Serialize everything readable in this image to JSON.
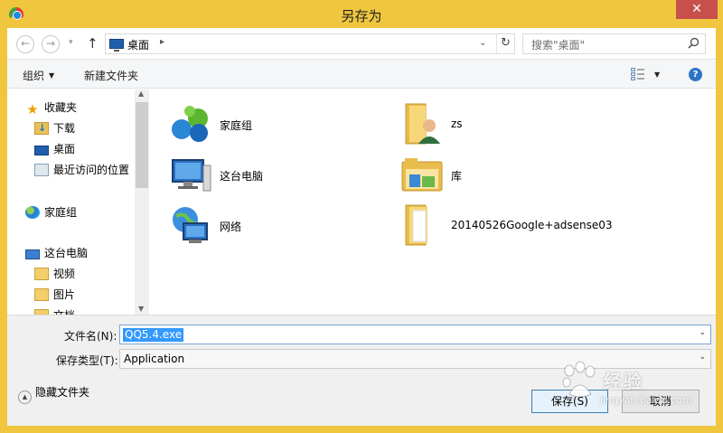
{
  "window": {
    "title": "另存为",
    "close_label": "✕"
  },
  "nav": {
    "back_label": "←",
    "forward_label": "→",
    "recent_label": "▾",
    "up_label": "↑",
    "address": {
      "location": "桌面",
      "separator": "▸",
      "dropdown": "⌄",
      "refresh": "↻"
    },
    "search": {
      "placeholder": "搜索\"桌面\""
    }
  },
  "commands": {
    "organize": "组织",
    "organize_caret": "▼",
    "new_folder": "新建文件夹",
    "view_caret": "▼",
    "help": "?"
  },
  "sidebar": {
    "items": [
      {
        "label": "收藏夹",
        "icon": "star-icon"
      },
      {
        "label": "下载",
        "icon": "downloads-folder-icon"
      },
      {
        "label": "桌面",
        "icon": "desktop-icon"
      },
      {
        "label": "最近访问的位置",
        "icon": "recent-places-icon"
      },
      {
        "label": "家庭组",
        "icon": "homegroup-icon"
      },
      {
        "label": "这台电脑",
        "icon": "computer-icon"
      },
      {
        "label": "视频",
        "icon": "videos-folder-icon"
      },
      {
        "label": "图片",
        "icon": "pictures-folder-icon"
      },
      {
        "label": "文档",
        "icon": "documents-folder-icon"
      }
    ]
  },
  "files": [
    {
      "label": "家庭组",
      "icon": "homegroup-icon"
    },
    {
      "label": "zs",
      "icon": "user-folder-icon"
    },
    {
      "label": "这台电脑",
      "icon": "computer-icon"
    },
    {
      "label": "库",
      "icon": "libraries-icon"
    },
    {
      "label": "网络",
      "icon": "network-icon"
    },
    {
      "label": "20140526Google+adsense03",
      "icon": "folder-icon"
    }
  ],
  "form": {
    "filename_label": "文件名(N):",
    "filename_value": "QQ5.4.exe",
    "filetype_label": "保存类型(T):",
    "filetype_value": "Application",
    "dropdown": "⌄",
    "hide_folders": "隐藏文件夹",
    "hide_folders_caret": "▲",
    "save": "保存(S)",
    "cancel": "取消"
  },
  "watermark": {
    "text": "经验",
    "url": "jingyan.baidu.com"
  },
  "colors": {
    "frame": "#f0c63f",
    "close": "#c7504d",
    "selection": "#3399ff",
    "accent": "#2b74c7"
  }
}
